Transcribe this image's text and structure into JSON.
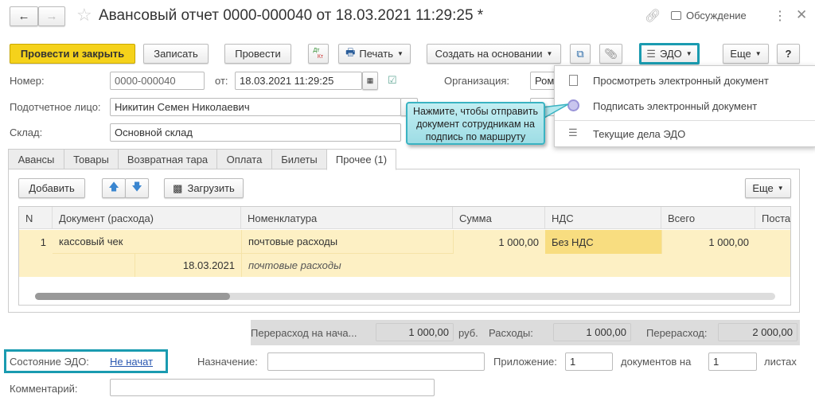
{
  "header": {
    "title": "Авансовый отчет 0000-000040 от 18.03.2021 11:29:25 *",
    "discussion": "Обсуждение"
  },
  "toolbar": {
    "post_close": "Провести и закрыть",
    "save": "Записать",
    "post": "Провести",
    "dtkt_top": "Дт",
    "dtkt_bottom": "Кт",
    "print": "Печать",
    "create_based": "Создать на основании",
    "edo": "ЭДО",
    "more": "Еще",
    "help": "?"
  },
  "fields": {
    "number_label": "Номер:",
    "number": "0000-000040",
    "date_label": "от:",
    "date": "18.03.2021 11:29:25",
    "org_label": "Организация:",
    "org": "Ром",
    "person_label": "Подотчетное лицо:",
    "person": "Никитин Семен Николаевич",
    "warehouse_label": "Склад:",
    "warehouse": "Основной склад"
  },
  "edo_menu": {
    "items": [
      "Просмотреть электронный документ",
      "Подписать электронный документ",
      "Текущие дела ЭДО"
    ]
  },
  "tooltip": "Нажмите, чтобы отправить документ сотрудникам на подпись по маршруту",
  "tabs": [
    "Авансы",
    "Товары",
    "Возвратная тара",
    "Оплата",
    "Билеты",
    "Прочее (1)"
  ],
  "table_toolbar": {
    "add": "Добавить",
    "load": "Загрузить",
    "more": "Еще"
  },
  "table": {
    "columns": [
      "N",
      "Документ (расхода)",
      "Номенклатура",
      "Сумма",
      "НДС",
      "Всего",
      "Поста"
    ],
    "rows": [
      {
        "n": "1",
        "doc": "кассовый чек",
        "doc_date": "18.03.2021",
        "item": "почтовые расходы",
        "item2": "почтовые расходы",
        "sum": "1 000,00",
        "vat": "Без НДС",
        "total": "1 000,00"
      }
    ]
  },
  "totals": {
    "overspend_start_label": "Перерасход на нача...",
    "overspend_start": "1 000,00",
    "currency": "руб.",
    "expenses_label": "Расходы:",
    "expenses": "1 000,00",
    "overspend_label": "Перерасход:",
    "overspend": "2 000,00"
  },
  "bottom": {
    "edo_state_label": "Состояние ЭДО:",
    "edo_state": "Не начат",
    "purpose_label": "Назначение:",
    "purpose": "",
    "attachment_label": "Приложение:",
    "attachment": "1",
    "docs_on": "документов на",
    "sheets": "1",
    "sheets_label": "листах",
    "comment_label": "Комментарий:",
    "comment": ""
  }
}
